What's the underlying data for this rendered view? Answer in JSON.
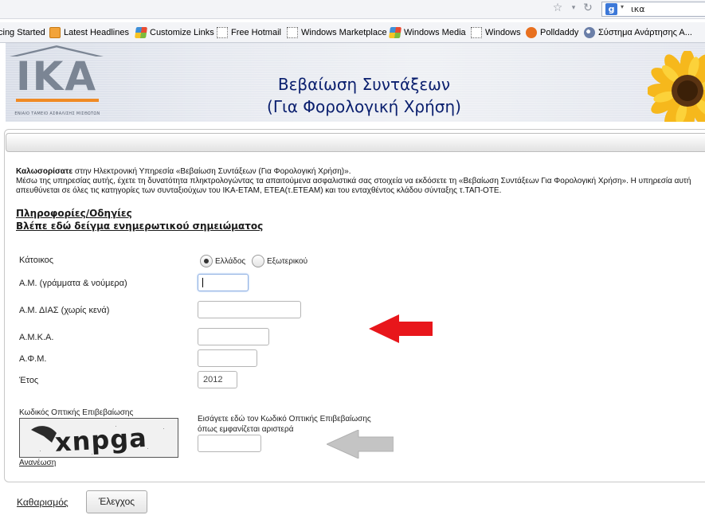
{
  "browser": {
    "search_engine_icon": "google-icon",
    "search_value": "ικα",
    "bookmarks": [
      {
        "label": "cing Started",
        "icon": "page-icon"
      },
      {
        "label": "Latest Headlines",
        "icon": "rss-icon"
      },
      {
        "label": "Customize Links",
        "icon": "windows-icon"
      },
      {
        "label": "Free Hotmail",
        "icon": "page-icon"
      },
      {
        "label": "Windows Marketplace",
        "icon": "page-icon"
      },
      {
        "label": "Windows Media",
        "icon": "windows-icon"
      },
      {
        "label": "Windows",
        "icon": "page-icon"
      },
      {
        "label": "Polldaddy",
        "icon": "polldaddy-icon"
      },
      {
        "label": "Σύστημα Ανάρτησης Α...",
        "icon": "globe-icon"
      }
    ]
  },
  "header": {
    "logo_text": "ΙΚΑ",
    "logo_caption": "ΕΝΙΑΙΟ ΤΑΜΕΙΟ ΑΣΦΑΛΙΣΗΣ ΜΙΣΘΩΤΩΝ",
    "title_line1": "Βεβαίωση Συντάξεων",
    "title_line2": "(Για Φορολογική Χρήση)"
  },
  "intro": {
    "welcome_bold": "Καλωσορίσατε",
    "welcome_rest": " στην Ηλεκτρονική Υπηρεσία «Βεβαίωση Συντάξεων (Για Φορολογική Χρήση)».",
    "line2": "Μέσω της υπηρεσίας αυτής, έχετε τη δυνατότητα πληκτρολογώντας τα απαιτούμενα ασφαλιστικά σας στοιχεία να εκδόσετε τη «Βεβαίωση Συντάξεων Για Φορολογική Χρήση». Η υπηρεσία αυτή απευθύνεται σε όλες τις κατηγορίες των συνταξιούχων του ΙΚΑ-ΕΤΑΜ, ΕΤΕΑ(τ.ΕΤΕΑΜ) και του ενταχθέντος κλάδου σύνταξης τ.ΤΑΠ-ΟΤΕ."
  },
  "links": {
    "info": "Πληροφορίες/Οδηγίες",
    "sample": "Βλέπε εδώ δείγμα ενημερωτικού σημειώματος"
  },
  "form": {
    "residence_label": "Κάτοικος",
    "residence_options": [
      "Ελλάδος",
      "Εξωτερικού"
    ],
    "residence_selected": "Ελλάδος",
    "am_label": "Α.Μ. (γράμματα & νούμερα)",
    "am_value": "",
    "dias_label": "Α.Μ. ΔΙΑΣ (χωρίς κενά)",
    "dias_value": "",
    "amka_label": "Α.Μ.Κ.Α.",
    "amka_value": "",
    "afm_label": "Α.Φ.Μ.",
    "afm_value": "",
    "year_label": "Έτος",
    "year_value": "2012",
    "captcha_label": "Κωδικός Οπτικής Επιβεβαίωσης",
    "captcha_text": "xnpga",
    "captcha_refresh": "Ανανέωση",
    "captcha_instruction_line1": "Εισάγετε εδώ τον Κωδικό Οπτικής Επιβεβαίωσης",
    "captcha_instruction_line2": "όπως εμφανίζεται αριστερά",
    "captcha_value": ""
  },
  "actions": {
    "clear_label": "Καθαρισμός",
    "submit_label": "Έλεγχος"
  },
  "annotations": {
    "red_arrow_color": "#e8161b",
    "grey_arrow_color": "#c4c4c4"
  }
}
